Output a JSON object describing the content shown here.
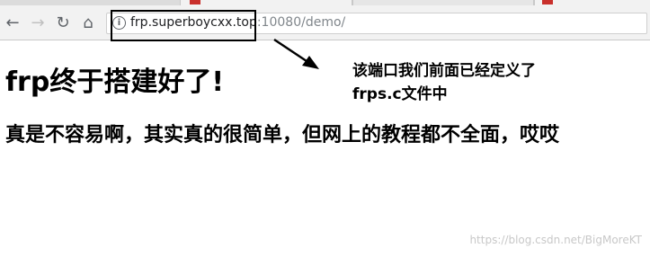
{
  "browser": {
    "url_host": "frp.superboycxx.top",
    "url_port_path": ":10080/demo/",
    "icons": [
      "back-arrow-icon",
      "forward-arrow-icon",
      "reload-icon",
      "home-icon",
      "info-icon"
    ]
  },
  "page": {
    "heading": "frp终于搭建好了!",
    "subheading": "真是不容易啊，其实真的很简单，但网上的教程都不全面，哎哎"
  },
  "annotation": {
    "line1": "该端口我们前面已经定义了",
    "line2": "frps.c文件中"
  },
  "watermark": "https://blog.csdn.net/BigMoreKT",
  "colors": {
    "annotation_box": "#000000",
    "tab_favicon": "#c9302c"
  }
}
